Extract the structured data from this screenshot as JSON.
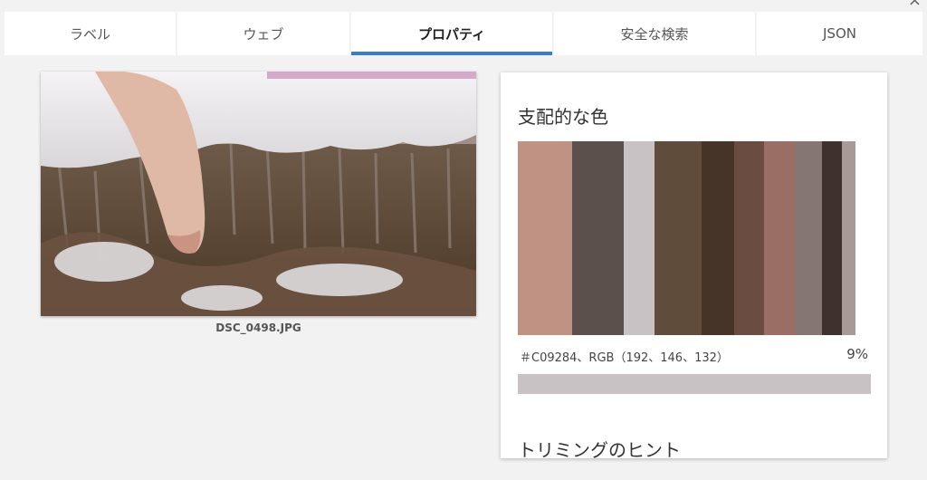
{
  "tabs": [
    {
      "label": "ラベル",
      "active": false
    },
    {
      "label": "ウェブ",
      "active": false
    },
    {
      "label": "プロパティ",
      "active": true
    },
    {
      "label": "安全な検索",
      "active": false
    },
    {
      "label": "JSON",
      "active": false
    }
  ],
  "image": {
    "filename": "DSC_0498.JPG"
  },
  "properties": {
    "dominant_colors_title": "支配的な色",
    "palette": [
      {
        "color": "#C09284",
        "weight": 0.16
      },
      {
        "color": "#5B504C",
        "weight": 0.155
      },
      {
        "color": "#C8C2C4",
        "weight": 0.09
      },
      {
        "color": "#5F4C3A",
        "weight": 0.14
      },
      {
        "color": "#463428",
        "weight": 0.095
      },
      {
        "color": "#6B4C41",
        "weight": 0.09
      },
      {
        "color": "#9A6E64",
        "weight": 0.09
      },
      {
        "color": "#857674",
        "weight": 0.08
      },
      {
        "color": "#3F322E",
        "weight": 0.06
      },
      {
        "color": "#A89A97",
        "weight": 0.04
      }
    ],
    "selected_color_info": "＃C09284、RGB（192、146、132）",
    "selected_color_pct": "9%",
    "crop_hints_title": "トリミングのヒント"
  }
}
